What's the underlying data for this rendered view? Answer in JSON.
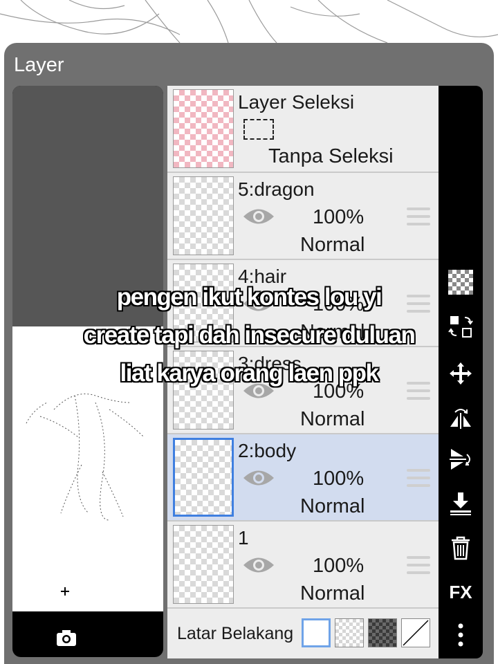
{
  "panel": {
    "title": "Layer"
  },
  "layers": [
    {
      "name": "Layer Seleksi",
      "status": "Tanpa Seleksi"
    },
    {
      "name": "5:dragon",
      "opacity": "100%",
      "blend": "Normal"
    },
    {
      "name": "4:hair",
      "opacity": "100%",
      "blend": "Normal"
    },
    {
      "name": "3:dress",
      "opacity": "100%",
      "blend": "Normal"
    },
    {
      "name": "2:body",
      "opacity": "100%",
      "blend": "Normal",
      "selected": true
    },
    {
      "name": "1",
      "opacity": "100%",
      "blend": "Normal"
    }
  ],
  "background": {
    "label": "Latar Belakang",
    "options": [
      "white",
      "transparent",
      "dark-checker",
      "none"
    ],
    "selected": "white"
  },
  "toolbar": {
    "icons": [
      "checker-icon",
      "transform-icon",
      "move-icon",
      "flip-horizontal-icon",
      "flip-vertical-icon",
      "merge-down-icon",
      "trash-icon",
      "fx-icon",
      "more-icon"
    ],
    "fx_label": "FX"
  },
  "left_tools": [
    "add-layer-icon",
    "flip-horizontal-icon",
    "add-folder-icon",
    "flip-vertical-icon",
    "camera-icon"
  ],
  "caption": {
    "line1": "pengen ikut kontes lou yi",
    "line2": "create tapi dah insecure duluan",
    "line3": "liat karya orang laen ppk"
  },
  "colors": {
    "panel": "#707070",
    "list": "#ededed",
    "selected_row": "#d2dcef",
    "accent": "#3f7fe0"
  }
}
